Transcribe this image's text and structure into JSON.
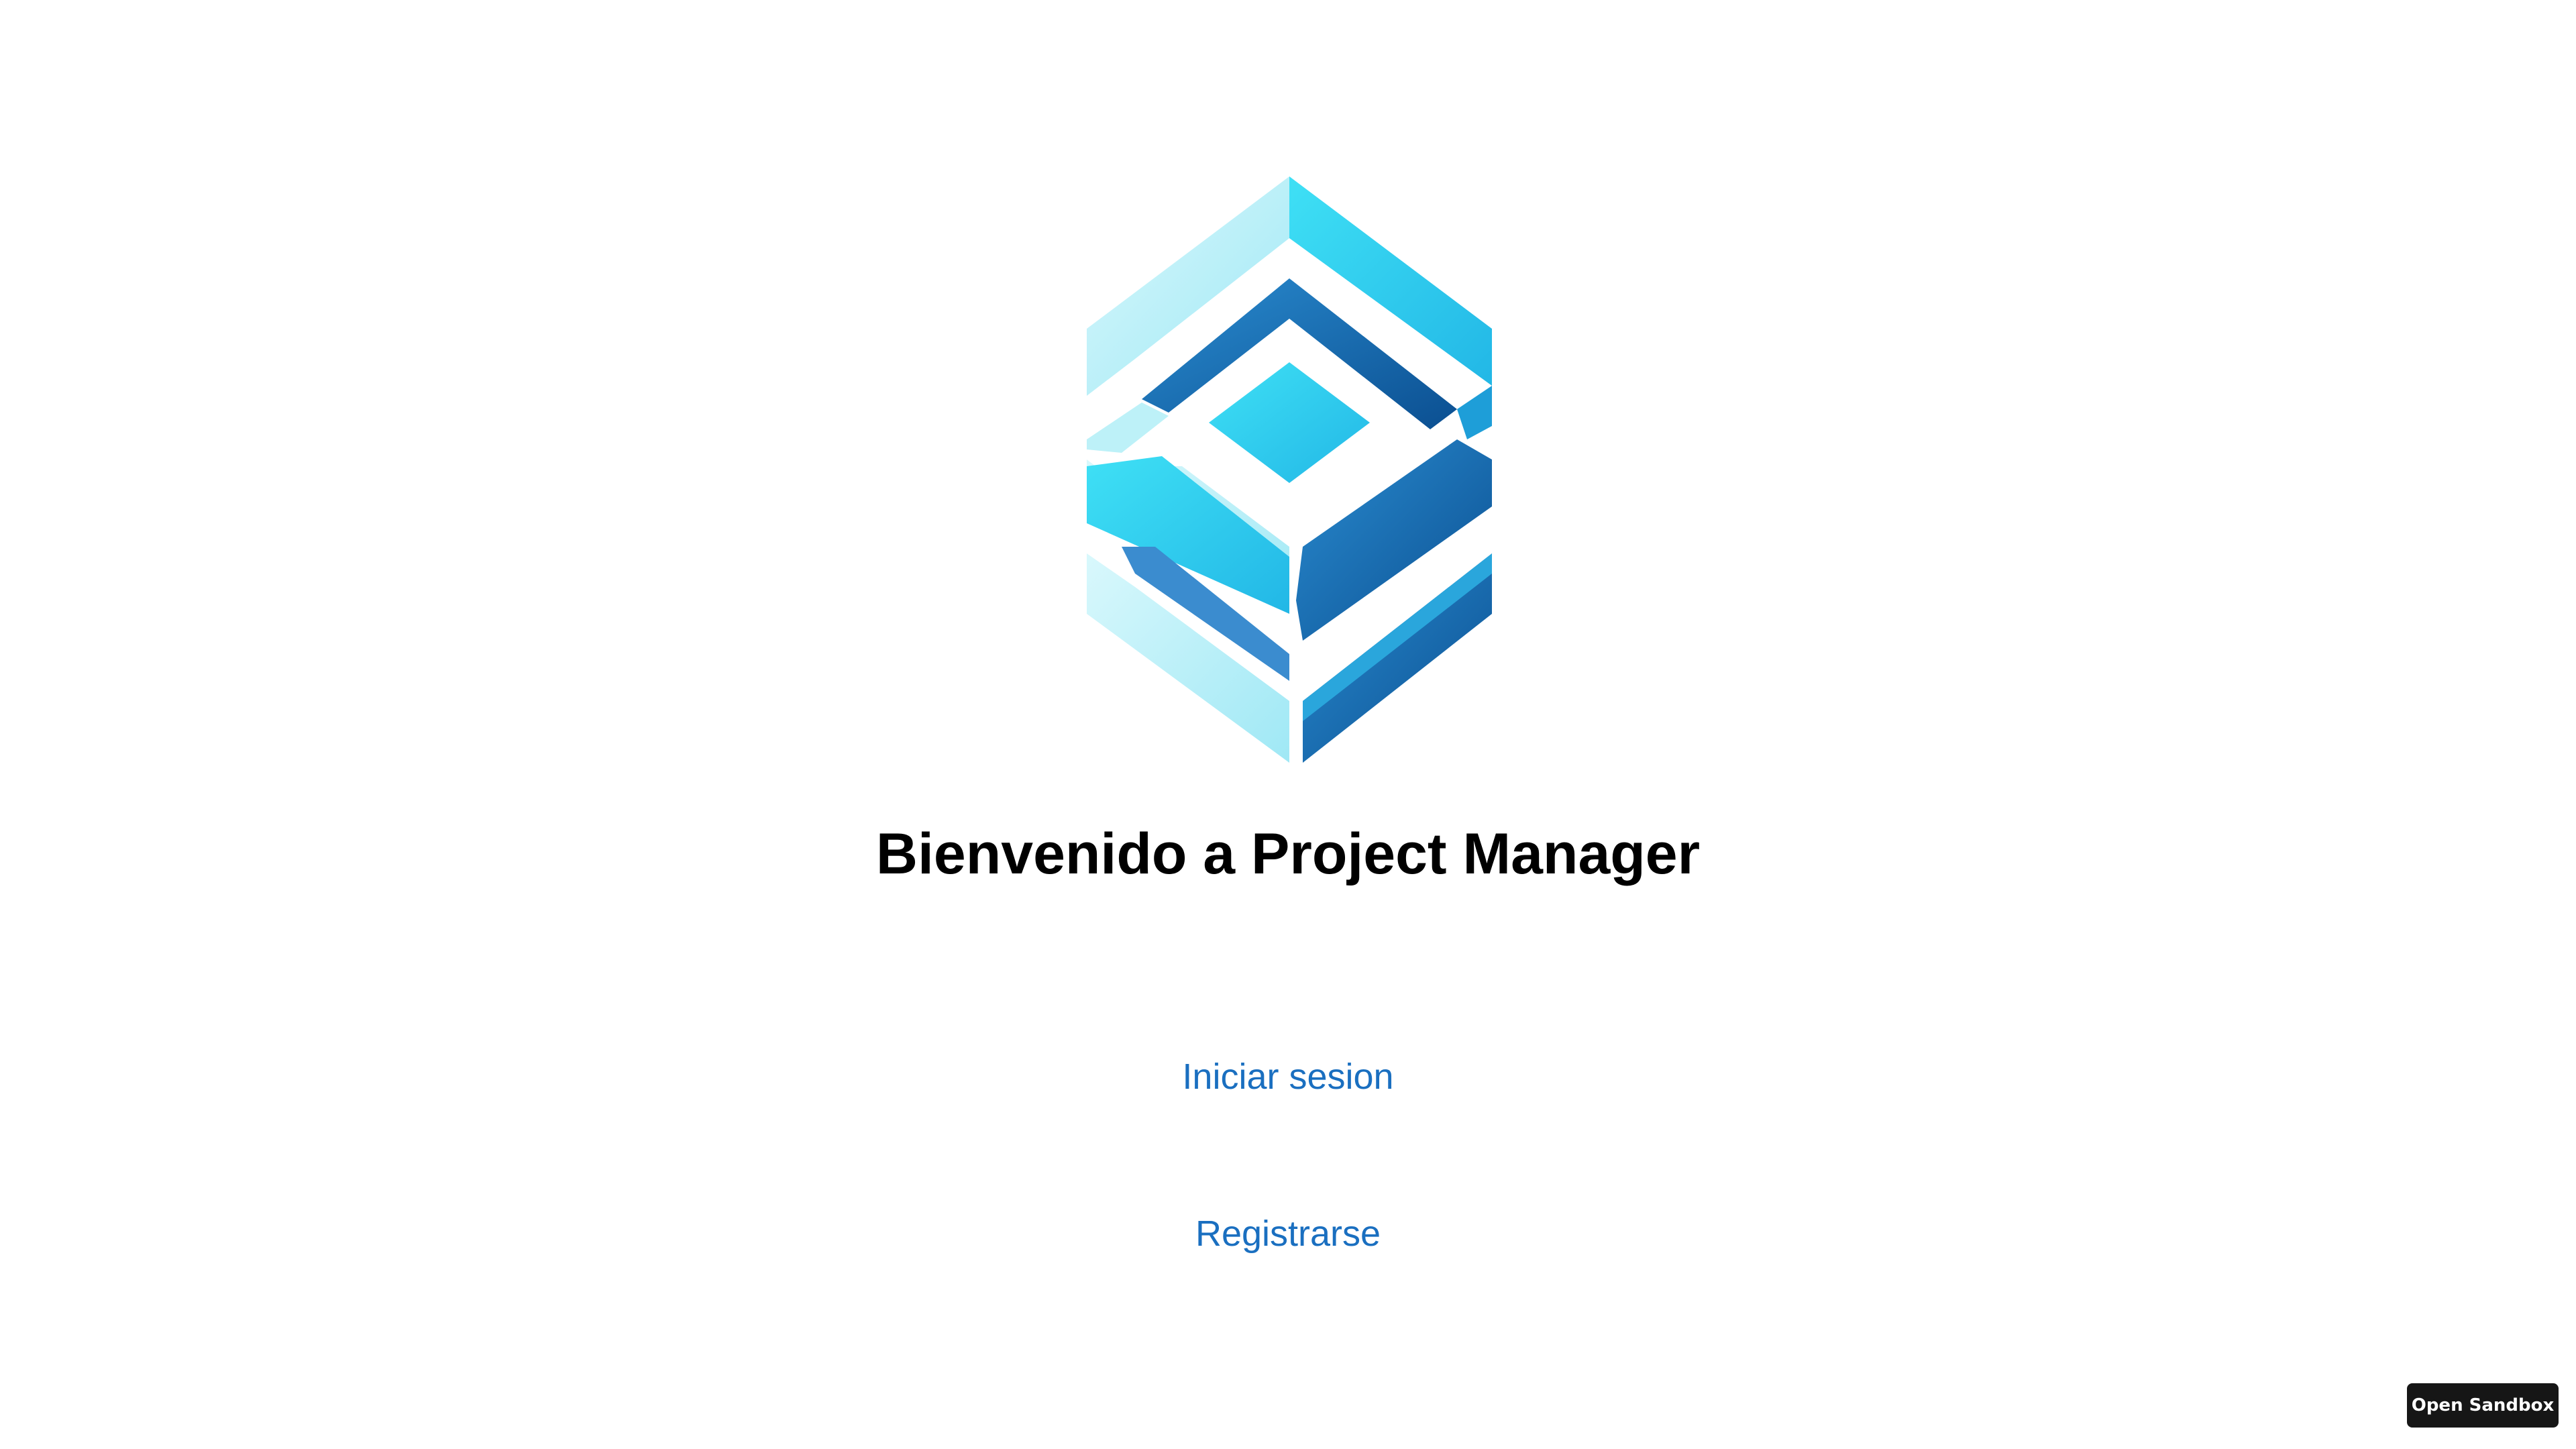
{
  "page": {
    "title": "Bienvenido a Project Manager"
  },
  "nav": {
    "login_label": "Iniciar sesion",
    "register_label": "Registrarse"
  },
  "sandbox": {
    "button_label": "Open Sandbox"
  },
  "logo": {
    "icon": "isometric-cube-logo",
    "colors": {
      "light": "#bff1f8",
      "cyan": "#36d6ef",
      "blue": "#2b9fd6",
      "dark": "#0d5fa3"
    }
  },
  "theme": {
    "link_color": "#1a6fc0",
    "title_color": "#000000",
    "sandbox_bg": "#161616"
  }
}
